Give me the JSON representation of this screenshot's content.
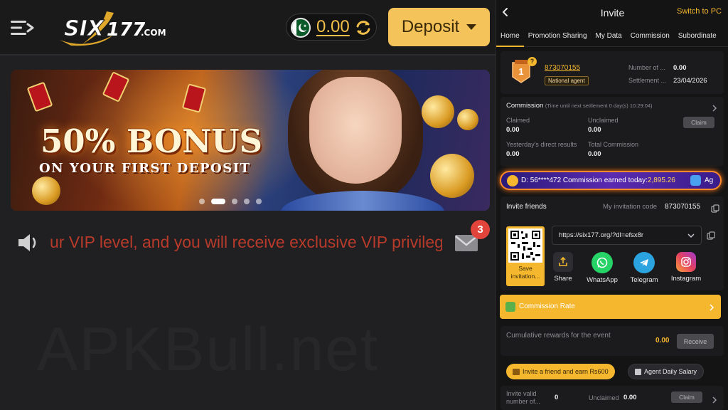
{
  "header": {
    "logo_text": "SIX177.COM",
    "balance": "0.00",
    "deposit_label": "Deposit"
  },
  "banner": {
    "headline": "50% BONUS",
    "subline": "ON YOUR FIRST DEPOSIT",
    "slide_count": 5,
    "active_slide": 2
  },
  "notice": {
    "marquee_text": "ur VIP level, and you will receive exclusive VIP privileg",
    "mail_count": "3"
  },
  "watermark": "APKBull.net",
  "panel": {
    "back_label": "<",
    "title": "Invite",
    "switch_label": "Switch to PC",
    "tabs": [
      "Home",
      "Promotion Sharing",
      "My Data",
      "Commission",
      "Subordinate"
    ],
    "active_tab": "Home",
    "agent": {
      "badge_number": "1",
      "id": "873070155",
      "level": "National agent",
      "number_label": "Number of ...",
      "number_value": "0.00",
      "settlement_label": "Settlement ...",
      "settlement_value": "23/04/2026"
    },
    "commission": {
      "title": "Commission",
      "countdown": "(Time until next settlement 0 day(s) 10:29:04)",
      "claimed_label": "Claimed",
      "claimed_value": "0.00",
      "unclaimed_label": "Unclaimed",
      "unclaimed_value": "0.00",
      "claim_label": "Claim",
      "yesterday_label": "Yesterday's direct results",
      "yesterday_value": "0.00",
      "total_label": "Total Commission",
      "total_value": "0.00"
    },
    "ticker": {
      "text": "D: 56****472 Commission earned today:",
      "amount": "2,895.26",
      "tail": "Ag"
    },
    "invite": {
      "title": "Invite friends",
      "code_label": "My invitation code",
      "code": "873070155",
      "link": "https://six177.org/?dl=efsx8r",
      "save_label": "Save invitation...",
      "share_targets": [
        "Share",
        "WhatsApp",
        "Telegram",
        "Instagram"
      ]
    },
    "commission_rate_label": "Commission Rate",
    "cumulative": {
      "label": "Cumulative rewards for the event",
      "value": "0.00",
      "button": "Receive"
    },
    "invite_earn_label": "Invite a friend and earn Rs600",
    "agent_salary_label": "Agent Daily Salary",
    "bottom": {
      "invite_valid_label": "Invite valid number of...",
      "invite_valid_value": "0",
      "unclaimed_label": "Unclaimed",
      "unclaimed_value": "0.00",
      "claim_label": "Claim"
    }
  },
  "colors": {
    "accent": "#f4b72e",
    "deposit": "#f4c35a",
    "marquee": "#b73a2a",
    "badge": "#e0443a"
  }
}
